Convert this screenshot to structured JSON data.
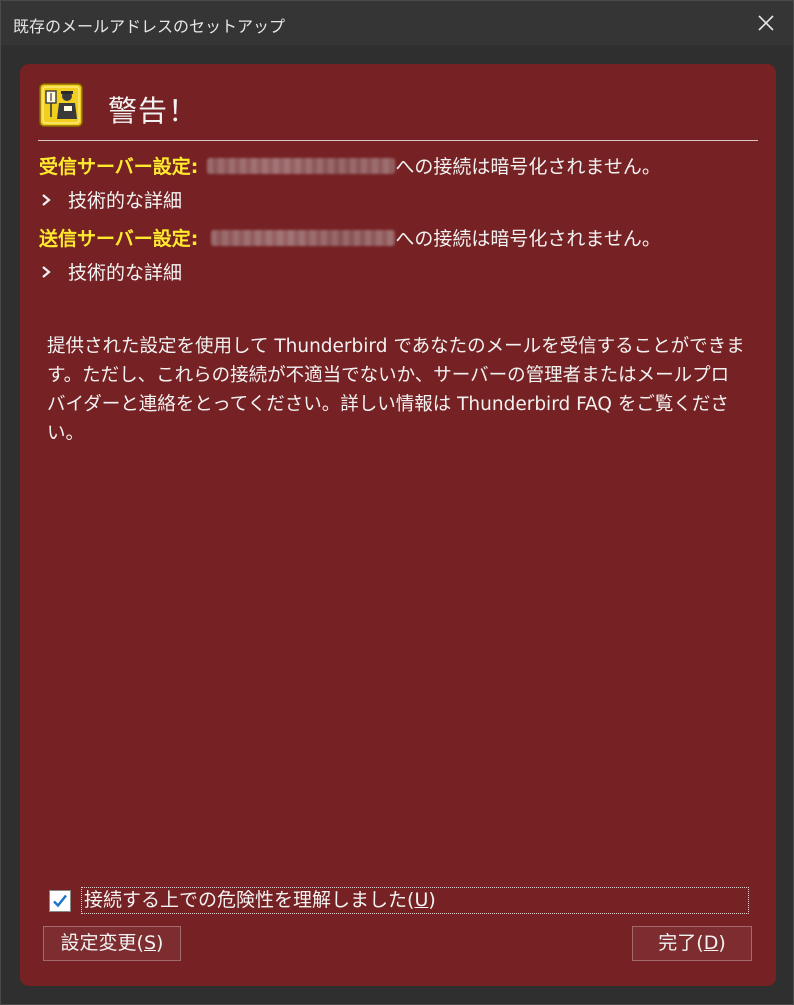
{
  "window": {
    "title": "既存のメールアドレスのセットアップ",
    "close_icon": "close-icon"
  },
  "warning": {
    "icon": "warning-security-officer-icon",
    "heading": "警告！",
    "incoming": {
      "label": "受信サーバー設定:",
      "host_redacted": true,
      "message": "への接続は暗号化されません。",
      "details_label": "技術的な詳細"
    },
    "outgoing": {
      "label": "送信サーバー設定:",
      "host_redacted": true,
      "message": "への接続は暗号化されません。",
      "details_label": "技術的な詳細"
    },
    "paragraph": "提供された設定を使用して Thunderbird であなたのメールを受信することができます。ただし、これらの接続が不適当でないか、サーバーの管理者またはメールプロバイダーと連絡をとってください。詳しい情報は Thunderbird FAQ をご覧ください。"
  },
  "acknowledge": {
    "checked": true,
    "label_main": "接続する上での危険性を理解しました",
    "label_open": "(",
    "label_accesskey": "U",
    "label_close": ")"
  },
  "buttons": {
    "settings_main": "設定変更",
    "settings_open": "(",
    "settings_accesskey": "S",
    "settings_close": ")",
    "done_main": "完了",
    "done_open": "(",
    "done_accesskey": "D",
    "done_close": ")"
  },
  "colors": {
    "panel": "#762123",
    "label_yellow": "#ffea2e",
    "titlebar": "#353535"
  }
}
